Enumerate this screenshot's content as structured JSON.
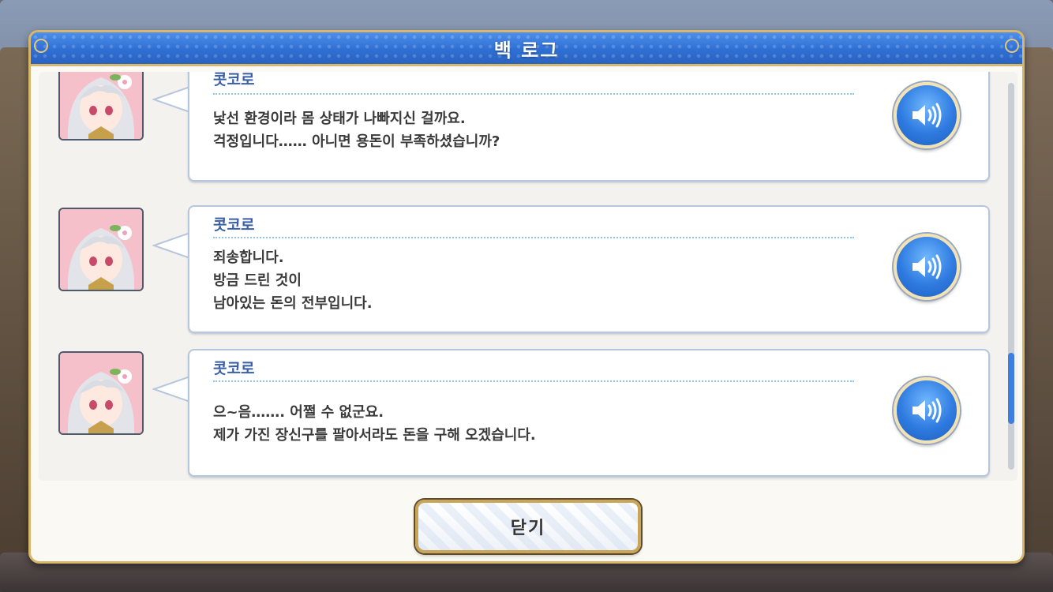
{
  "window": {
    "title": "백 로그"
  },
  "entries": [
    {
      "speaker": "콧코로",
      "lines": [
        "낯선 환경이라 몸 상태가 나빠지신 걸까요.",
        "걱정입니다…… 아니면 용돈이 부족하셨습니까?"
      ]
    },
    {
      "speaker": "콧코로",
      "lines": [
        "죄송합니다.",
        "방금 드린 것이",
        "남아있는 돈의 전부입니다."
      ]
    },
    {
      "speaker": "콧코로",
      "lines": [
        "으~음……. 어쩔 수 없군요.",
        "제가 가진 장신구를 팔아서라도 돈을 구해 오겠습니다."
      ]
    }
  ],
  "close_button": {
    "label": "닫기"
  },
  "colors": {
    "title_bar": "#2f6fd3",
    "speaker_name": "#3a5fa8",
    "voice_button": "#2f7be0",
    "frame_gold": "#d8b66a"
  },
  "icons": {
    "voice": "speaker-volume-icon",
    "portrait": "character-portrait"
  }
}
